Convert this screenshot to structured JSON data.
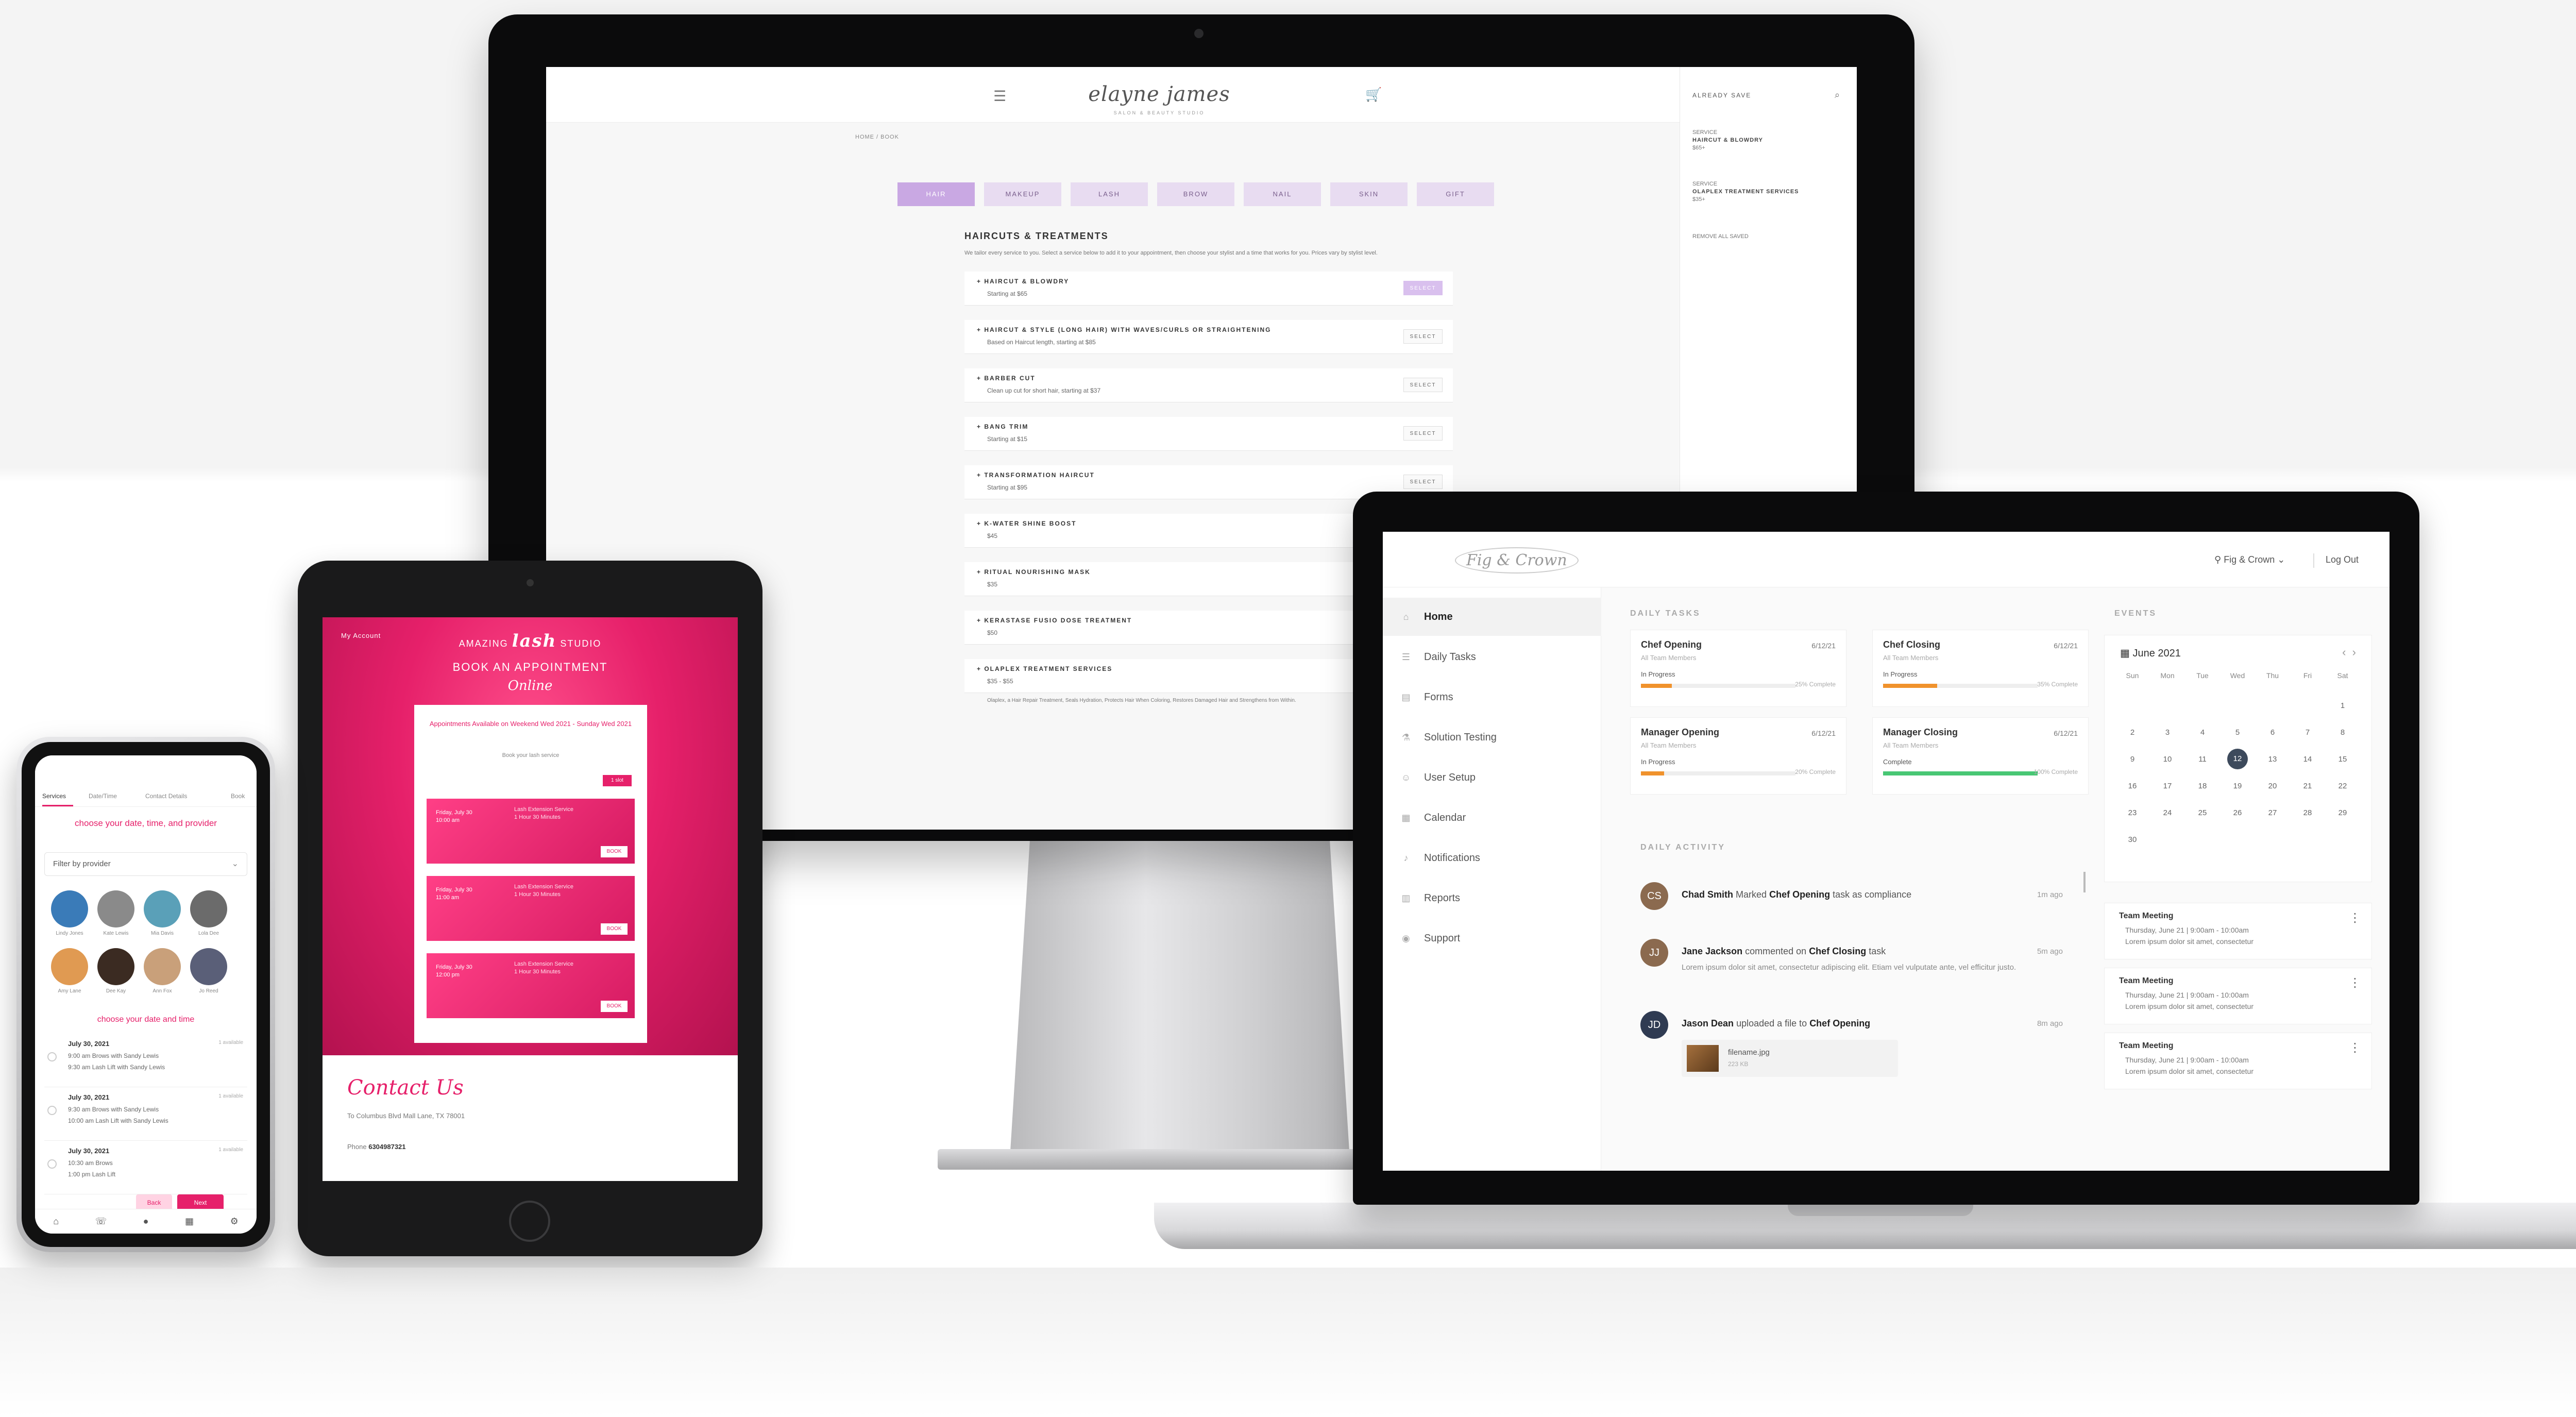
{
  "salon": {
    "logo": "elayne james",
    "tagline": "SALON & BEAUTY STUDIO",
    "crumbs": "HOME / BOOK",
    "categories": [
      "HAIR",
      "MAKEUP",
      "LASH",
      "BROW",
      "NAIL",
      "SKIN",
      "GIFT"
    ],
    "heading": "HAIRCUTS & TREATMENTS",
    "intro": "We tailor every service to you. Select a service below to add it to your appointment, then choose your stylist and a time that works for you. Prices vary by stylist level.",
    "services": [
      {
        "name": "+ HAIRCUT & BLOWDRY",
        "price": "Starting at $65",
        "button": "SELECT"
      },
      {
        "name": "+ HAIRCUT & STYLE (LONG HAIR) WITH WAVES/CURLS OR STRAIGHTENING",
        "price": "Based on Haircut length, starting at $85",
        "button": "SELECT"
      },
      {
        "name": "+ BARBER CUT",
        "price": "Clean up cut for short hair, starting at $37",
        "button": "SELECT"
      },
      {
        "name": "+ BANG TRIM",
        "price": "Starting at $15",
        "button": "SELECT"
      },
      {
        "name": "+ TRANSFORMATION HAIRCUT",
        "price": "Starting at $95",
        "button": "SELECT"
      },
      {
        "name": "+ K-WATER SHINE BOOST",
        "price": "$45",
        "button": ""
      },
      {
        "name": "+ RITUAL NOURISHING MASK",
        "price": "$35",
        "button": ""
      },
      {
        "name": "+ KERASTASE FUSIO DOSE TREATMENT",
        "price": "$50",
        "button": ""
      },
      {
        "name": "+ OLAPLEX TREATMENT SERVICES",
        "price": "$35 - $55",
        "button": ""
      }
    ],
    "olaplex_detail": "Olaplex, a Hair Repair Treatment, Seals Hydration, Protects Hair When Coloring, Restores Damaged Hair and Strengthens from Within.",
    "sidebar_title": "ALREADY SAVE",
    "sidebar_items": [
      {
        "label": "SERVICE",
        "value": "HAIRCUT & BLOWDRY",
        "extra": "$65+"
      },
      {
        "label": "SERVICE",
        "value": "OLAPLEX TREATMENT SERVICES",
        "extra": "$35+"
      }
    ],
    "sidebar_link": "REMOVE ALL SAVED"
  },
  "dashboard": {
    "logo": "Fig & Crown",
    "location": "Fig & Crown",
    "logout": "Log Out",
    "nav": [
      {
        "label": "Home",
        "icon": "home-icon",
        "glyph": "⌂"
      },
      {
        "label": "Daily Tasks",
        "icon": "tasks-icon",
        "glyph": "☰"
      },
      {
        "label": "Forms",
        "icon": "forms-icon",
        "glyph": "▤"
      },
      {
        "label": "Solution Testing",
        "icon": "flask-icon",
        "glyph": "⚗"
      },
      {
        "label": "User Setup",
        "icon": "user-icon",
        "glyph": "☺"
      },
      {
        "label": "Calendar",
        "icon": "calendar-icon",
        "glyph": "▦"
      },
      {
        "label": "Notifications",
        "icon": "bell-icon",
        "glyph": "♪"
      },
      {
        "label": "Reports",
        "icon": "reports-icon",
        "glyph": "▥"
      },
      {
        "label": "Support",
        "icon": "support-icon",
        "glyph": "◉"
      }
    ],
    "daily_tasks_title": "DAILY TASKS",
    "tasks": [
      {
        "title": "Chef Opening",
        "date": "6/12/21",
        "sub": "All Team Members",
        "status": "In Progress",
        "progress": 0.2,
        "done": "25% Complete",
        "color": "#f0922c"
      },
      {
        "title": "Chef Closing",
        "date": "6/12/21",
        "sub": "All Team Members",
        "status": "In Progress",
        "progress": 0.35,
        "done": "35% Complete",
        "color": "#f0922c"
      },
      {
        "title": "Manager Opening",
        "date": "6/12/21",
        "sub": "All Team Members",
        "status": "In Progress",
        "progress": 0.15,
        "done": "20% Complete",
        "color": "#f0922c"
      },
      {
        "title": "Manager Closing",
        "date": "6/12/21",
        "sub": "All Team Members",
        "status": "Complete",
        "progress": 1.0,
        "done": "100% Complete",
        "color": "#48c774"
      }
    ],
    "activity_title": "DAILY ACTIVITY",
    "activity": [
      {
        "initials": "CS",
        "who": "Chad Smith",
        "verb": "Marked",
        "what": "Chef Opening",
        "tail": "task as compliance",
        "time": "1m ago",
        "body": "",
        "file": "",
        "filesize": ""
      },
      {
        "initials": "JJ",
        "who": "Jane Jackson",
        "verb": "commented on",
        "what": "Chef Closing",
        "tail": "task",
        "time": "5m ago",
        "body": "Lorem ipsum dolor sit amet, consectetur adipiscing elit. Etiam vel vulputate ante, vel efficitur justo.",
        "file": "",
        "filesize": ""
      },
      {
        "initials": "JD",
        "who": "Jason Dean",
        "verb": "uploaded a file to",
        "what": "Chef Opening",
        "tail": "",
        "time": "8m ago",
        "body": "",
        "file": "filename.jpg",
        "filesize": "223 KB"
      }
    ],
    "events_title": "EVENTS",
    "calendar": {
      "month": "June 2021",
      "dows": [
        "Sun",
        "Mon",
        "Tue",
        "Wed",
        "Thu",
        "Fri",
        "Sat"
      ],
      "days": [
        "",
        "",
        "",
        "",
        "",
        "",
        "1",
        "2",
        "3",
        "4",
        "5",
        "6",
        "7",
        "8",
        "9",
        "10",
        "11",
        "12",
        "13",
        "14",
        "15",
        "16",
        "17",
        "18",
        "19",
        "20",
        "21",
        "22",
        "23",
        "24",
        "25",
        "26",
        "27",
        "28",
        "29",
        "30"
      ],
      "today": "12"
    },
    "events": [
      {
        "title": "Team Meeting",
        "time": "Thursday, June 21 | 9:00am - 10:00am",
        "desc": "Lorem ipsum dolor sit amet, consectetur"
      },
      {
        "title": "Team Meeting",
        "time": "Thursday, June 21 | 9:00am - 10:00am",
        "desc": "Lorem ipsum dolor sit amet, consectetur"
      },
      {
        "title": "Team Meeting",
        "time": "Thursday, June 21 | 9:00am - 10:00am",
        "desc": "Lorem ipsum dolor sit amet, consectetur"
      }
    ]
  },
  "lash": {
    "my_account": "My Account",
    "brand_pre": "AMAZING",
    "brand_script": "lash",
    "brand_post": "STUDIO",
    "book": "BOOK AN APPOINTMENT",
    "online": "Online",
    "availability": "Appointments Available on Weekend Wed 2021 - Sunday Wed 2021",
    "note": "Book your lash service",
    "tag": "1 slot",
    "slots": [
      {
        "left": "Friday, July 30\n10:00 am",
        "mid": "Lash Extension Service\n1 Hour 30 Minutes",
        "btn": "BOOK"
      },
      {
        "left": "Friday, July 30\n11:00 am",
        "mid": "Lash Extension Service\n1 Hour 30 Minutes",
        "btn": "BOOK"
      },
      {
        "left": "Friday, July 30\n12:00 pm",
        "mid": "Lash Extension Service\n1 Hour 30 Minutes",
        "btn": "BOOK"
      }
    ],
    "contact": "Contact Us",
    "address": "To Columbus Blvd Mall Lane, TX 78001",
    "phone_label": "Phone",
    "phone": "6304987321"
  },
  "phone": {
    "tabs": [
      "Services",
      "Date/Time",
      "Contact Details",
      "Book"
    ],
    "choose": "choose your date, time, and provider",
    "filter": "Filter by provider",
    "providers": [
      {
        "name": "Lindy Jones",
        "color": "#3a7bb8"
      },
      {
        "name": "Kate Lewis",
        "color": "#8a8a8a"
      },
      {
        "name": "Mia Davis",
        "color": "#5aa0b8"
      },
      {
        "name": "Lola Dee",
        "color": "#6b6b6b"
      },
      {
        "name": "Amy Lane",
        "color": "#e09a52"
      },
      {
        "name": "Dee Kay",
        "color": "#3b2b22"
      },
      {
        "name": "Ann Fox",
        "color": "#c9a07a"
      },
      {
        "name": "Jo Reed",
        "color": "#5a5f78"
      }
    ],
    "datetime": "choose your date and time",
    "rows": [
      {
        "date": "July 30, 2021",
        "l1": "9:00 am  Brows with Sandy Lewis",
        "l2": "9:30 am  Lash Lift with Sandy Lewis",
        "right": "1 available"
      },
      {
        "date": "July 30, 2021",
        "l1": "9:30 am  Brows with Sandy Lewis",
        "l2": "10:00 am  Lash Lift with Sandy Lewis",
        "right": "1 available"
      },
      {
        "date": "July 30, 2021",
        "l1": "10:30 am  Brows",
        "l2": "1:00 pm  Lash Lift",
        "right": "1 available"
      }
    ],
    "back": "Back",
    "next": "Next",
    "bottom_icons": [
      "⌂",
      "☏",
      "●",
      "▦",
      "⚙"
    ]
  }
}
